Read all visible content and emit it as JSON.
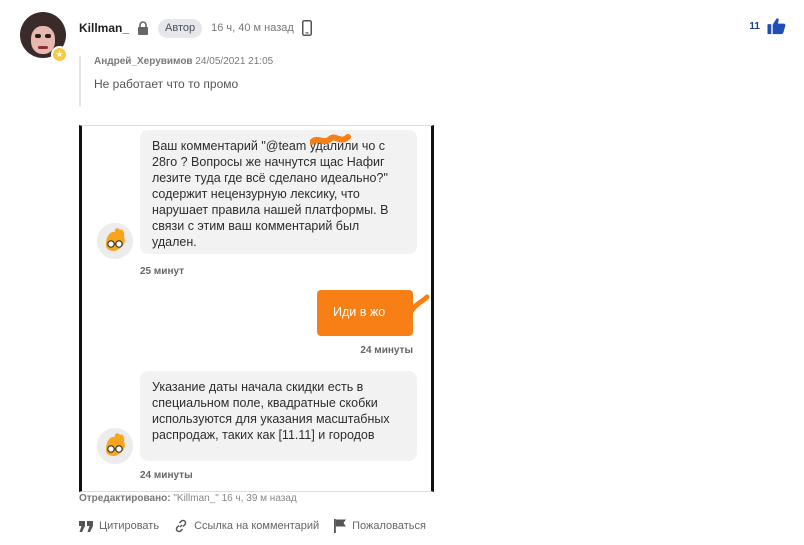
{
  "comment": {
    "username": "Killman_",
    "badge": "Автор",
    "time": "16 ч, 40 м назад",
    "likes": "11"
  },
  "quote": {
    "author": "Андрей_Херувимов",
    "date": "24/05/2021 21:05",
    "text": "Не работает что то промо"
  },
  "screenshot": {
    "message1": "Ваш комментарий \"@team   удалили чо с 28го ? Вопросы же начнутся щас Нафиг лезите туда где всё сделано идеально?\" содержит нецензурную лексику, что нарушает правила нашей платформы. В связи с этим ваш комментарий был удален.",
    "message1_time": "25 минут",
    "message2": "Иди в жо",
    "message2_time": "24 минуты",
    "message3": "Указание даты начала скидки есть в специальном поле, квадратные скобки используются для указания масштабных распродаж, таких как [11.11] и городов",
    "message3_time": "24 минуты",
    "bubble_color": "#f77f16"
  },
  "edited": {
    "label": "Отредактировано:",
    "value": "\"Killman_\" 16 ч, 39 м назад"
  },
  "actions": {
    "quote": "Цитировать",
    "link": "Ссылка на комментарий",
    "report": "Пожаловаться"
  },
  "colors": {
    "like_blue": "#1f4fb5",
    "accent_orange": "#f77f16",
    "badge_bg": "#e5e7eb"
  }
}
